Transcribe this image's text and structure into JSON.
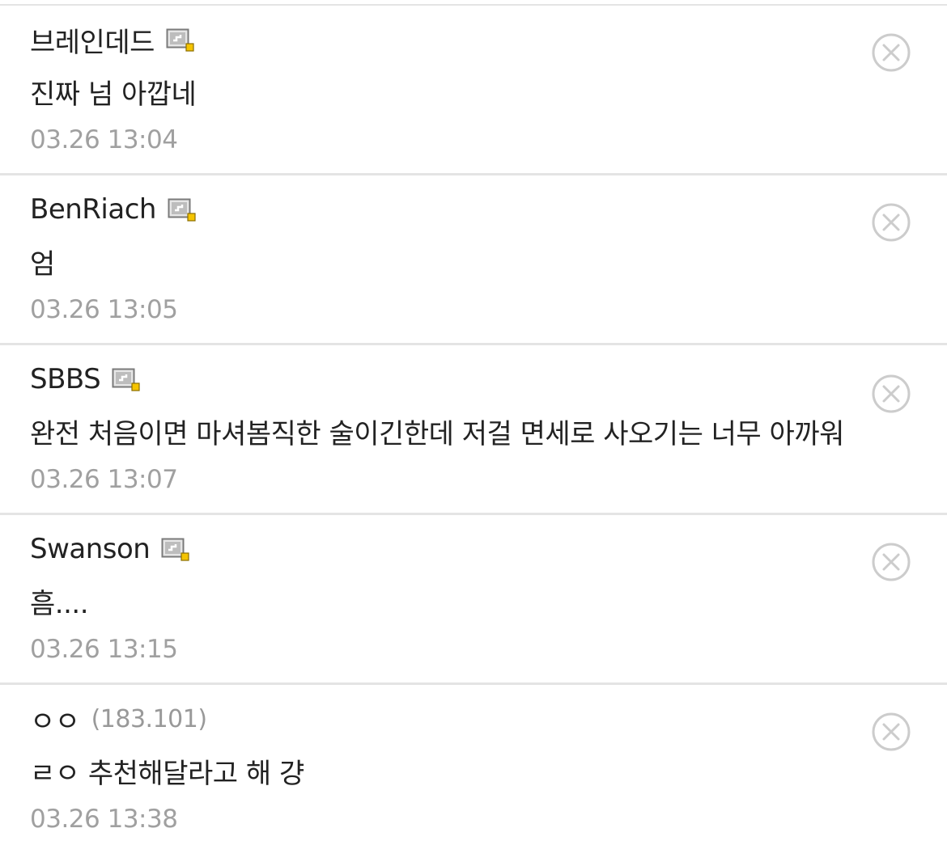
{
  "comments": [
    {
      "author": "브레인데드",
      "ip": "",
      "fixed_member": true,
      "text": "진짜 넘 아깝네",
      "time": "03.26 13:04"
    },
    {
      "author": "BenRiach",
      "ip": "",
      "fixed_member": true,
      "text": "엄",
      "time": "03.26 13:05"
    },
    {
      "author": "SBBS",
      "ip": "",
      "fixed_member": true,
      "text": "완전 처음이면 마셔봄직한 술이긴한데 저걸 면세로 사오기는 너무 아까워",
      "time": "03.26 13:07"
    },
    {
      "author": "Swanson",
      "ip": "",
      "fixed_member": true,
      "text": "흠....",
      "time": "03.26 13:15"
    },
    {
      "author": "ㅇㅇ",
      "ip": "(183.101)",
      "fixed_member": false,
      "text": "ㄹㅇ 추천해달라고 해 걍",
      "time": "03.26 13:38"
    }
  ],
  "icons": {
    "member_badge": "fixed-member-icon",
    "delete": "delete-circle-x-icon"
  },
  "colors": {
    "text": "#222222",
    "meta": "#a0a0a0",
    "divider": "#e4e4e4",
    "badge_accent": "#f5c400",
    "delete_icon": "#cccccc"
  }
}
